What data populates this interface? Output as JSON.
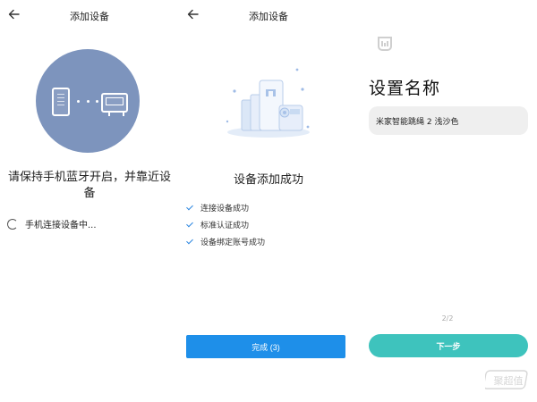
{
  "panel1": {
    "title": "添加设备",
    "message": "请保持手机蓝牙开启，并靠近设备",
    "status": "手机连接设备中..."
  },
  "panel2": {
    "title": "添加设备",
    "success": "设备添加成功",
    "steps": [
      "连接设备成功",
      "标准认证成功",
      "设备绑定账号成功"
    ],
    "done_button": "完成 (3)"
  },
  "panel3": {
    "heading": "设置名称",
    "name_value": "米家智能跳绳 2 浅沙色",
    "page_indicator": "2/2",
    "next_button": "下一步"
  },
  "watermark": "聚超值",
  "colors": {
    "circle": "#7d94bd",
    "primary_blue": "#1e8fe9",
    "next_teal": "#3ec3bd",
    "check_blue": "#2b86e0",
    "input_bg": "#efefef"
  }
}
